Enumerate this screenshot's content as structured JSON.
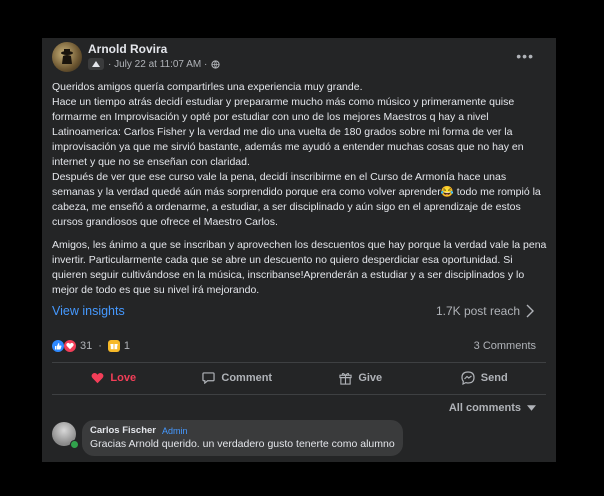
{
  "post": {
    "author": "Arnold Rovira",
    "timestamp": "· July 22 at 11:07 AM ·",
    "paragraphs": [
      "Queridos amigos quería compartirles una experiencia muy grande.\nHace un tiempo atrás decidí estudiar y prepararme mucho más como músico y primeramente quise formarme en Improvisación y opté por estudiar con uno de los mejores Maestros q hay a nivel Latinoamerica: Carlos Fisher y la verdad me dio una vuelta de 180 grados sobre mi forma de ver la improvisación ya que me sirvió bastante, además  me ayudó a entender muchas cosas que no hay en internet y que no se enseñan con claridad.\nDespués de ver que ese curso vale la pena, decidí inscribirme en el Curso de Armonía hace unas semanas y la verdad quedé aún más sorprendido porque era como volver aprender😂 todo me rompió la cabeza, me enseñó a ordenarme, a estudiar, a ser disciplinado y aún sigo en el aprendizaje de estos cursos grandiosos que ofrece el Maestro Carlos.",
      "Amigos, les ánimo a que se inscriban y aprovechen los descuentos que hay porque la verdad vale la pena invertir.  Particularmente cada que se abre un descuento no quiero desperdiciar esa oportunidad. Si quieren seguir cultivándose en la música, inscribanse!Aprenderán a estudiar y a ser disciplinados y lo mejor de todo es que su nivel irá mejorando."
    ],
    "view_insights": "View insights",
    "reach": "1.7K post reach",
    "reaction_count": "31",
    "gift_count": "1",
    "comments_count": "3 Comments"
  },
  "actions": {
    "love": "Love",
    "comment": "Comment",
    "give": "Give",
    "send": "Send"
  },
  "comments": {
    "filter_label": "All comments",
    "items": [
      {
        "name": "Carlos Fischer",
        "role": "Admin",
        "text": "Gracias Arnold querido. un verdadero gusto tenerte como alumno"
      }
    ]
  },
  "colors": {
    "card_bg": "#242526",
    "link_blue": "#4599ff",
    "love_red": "#f33e58"
  }
}
